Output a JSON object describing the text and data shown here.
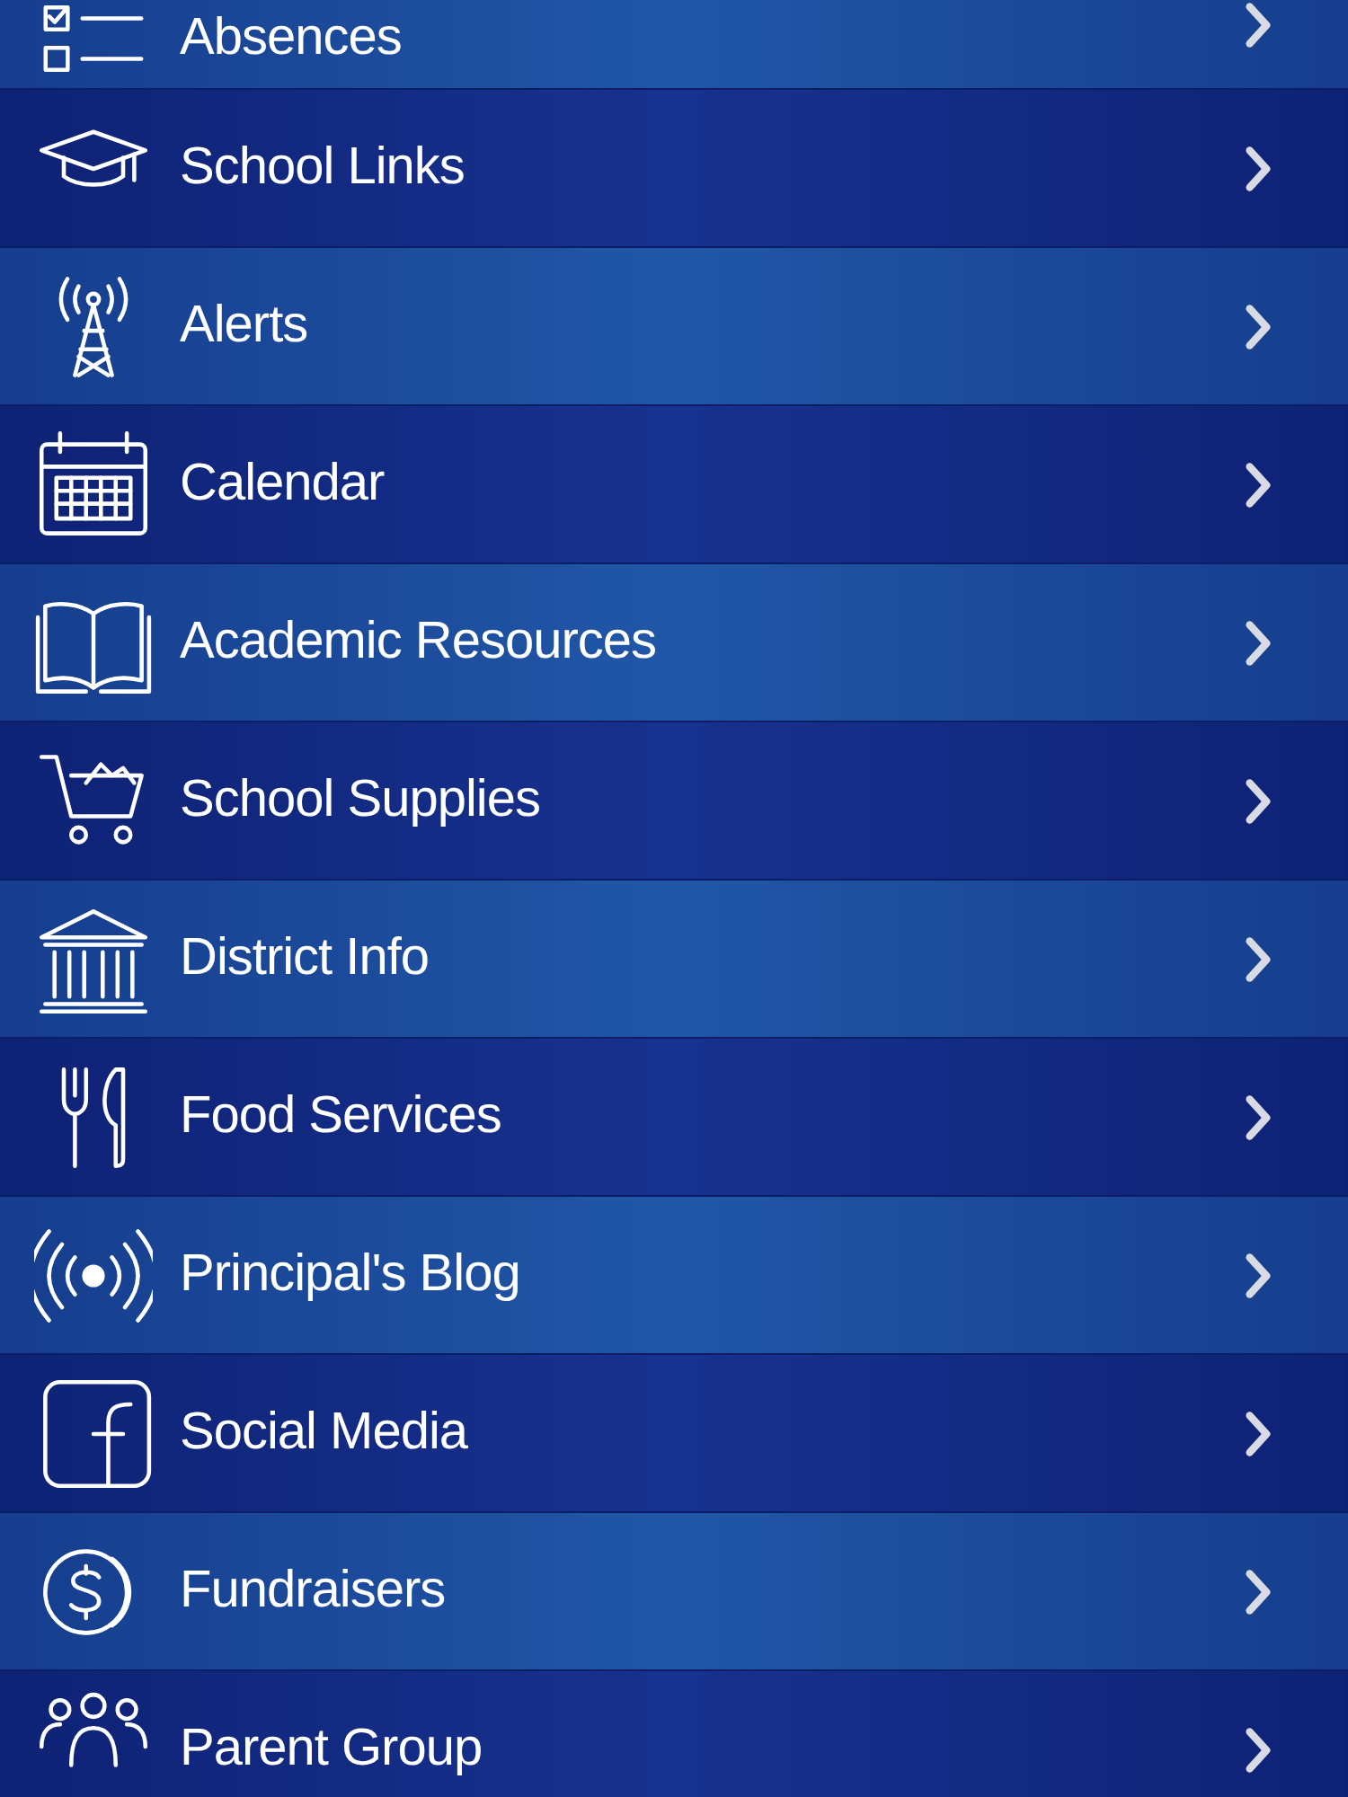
{
  "menu": [
    {
      "label": "Absences",
      "kind": "checklist"
    },
    {
      "label": "School Links",
      "kind": "cap"
    },
    {
      "label": "Alerts",
      "kind": "tower"
    },
    {
      "label": "Calendar",
      "kind": "calendar"
    },
    {
      "label": "Academic Resources",
      "kind": "book"
    },
    {
      "label": "School Supplies",
      "kind": "cart"
    },
    {
      "label": "District Info",
      "kind": "building"
    },
    {
      "label": "Food Services",
      "kind": "utensils"
    },
    {
      "label": "Principal's Blog",
      "kind": "broadcast"
    },
    {
      "label": "Social Media",
      "kind": "facebook"
    },
    {
      "label": "Fundraisers",
      "kind": "coin"
    },
    {
      "label": "Parent Group",
      "kind": "people"
    }
  ]
}
